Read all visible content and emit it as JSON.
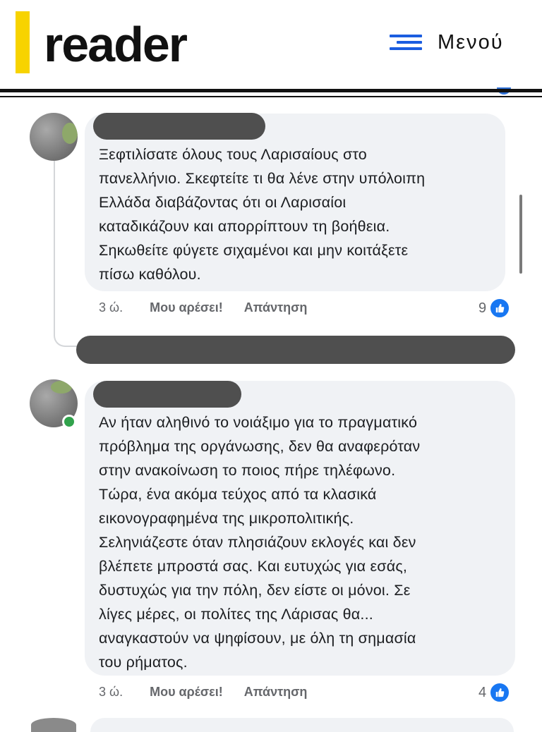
{
  "header": {
    "logo": "reader",
    "menu_label": "Μενού"
  },
  "comments": [
    {
      "lines": [
        "Ξεφτιλίσατε όλους τους Λαρισαίους στο",
        "πανελλήνιο. Σκεφτείτε τι θα λένε στην υπόλοιπη",
        "Ελλάδα διαβάζοντας ότι οι Λαρισαίοι",
        "καταδικάζουν και απορρίπτουν τη βοήθεια.",
        "Σηκωθείτε φύγετε σιχαμένοι και μην κοιτάξετε",
        "πίσω καθόλου."
      ],
      "time": "3 ώ.",
      "like_label": "Μου αρέσει!",
      "reply_label": "Απάντηση",
      "reactions": "9"
    },
    {
      "lines": [
        "Αν ήταν αληθινό το νοιάξιμο για το πραγματικό",
        "πρόβλημα της οργάνωσης, δεν θα αναφερόταν",
        "στην ανακοίνωση το ποιος πήρε τηλέφωνο.",
        "Τώρα, ένα ακόμα τεύχος από τα κλασικά",
        "εικονογραφημένα της μικροπολιτικής.",
        "Σεληνιάζεστε όταν πλησιάζουν εκλογές και δεν",
        "βλέπετε μπροστά σας. Και ευτυχώς για εσάς,",
        "δυστυχώς για την πόλη, δεν είστε οι μόνοι. Σε",
        "λίγες μέρες, οι πολίτες της Λάρισας θα...",
        "αναγκαστούν να ψηφίσουν, με όλη τη σημασία",
        "του ρήματος."
      ],
      "time": "3 ώ.",
      "like_label": "Μου αρέσει!",
      "reply_label": "Απάντηση",
      "reactions": "4"
    }
  ],
  "colors": {
    "brand_yellow": "#f7d300",
    "menu_blue": "#1b5de0",
    "like_blue": "#1877f2",
    "bubble_bg": "#f0f2f5",
    "online_green": "#31a24c"
  }
}
